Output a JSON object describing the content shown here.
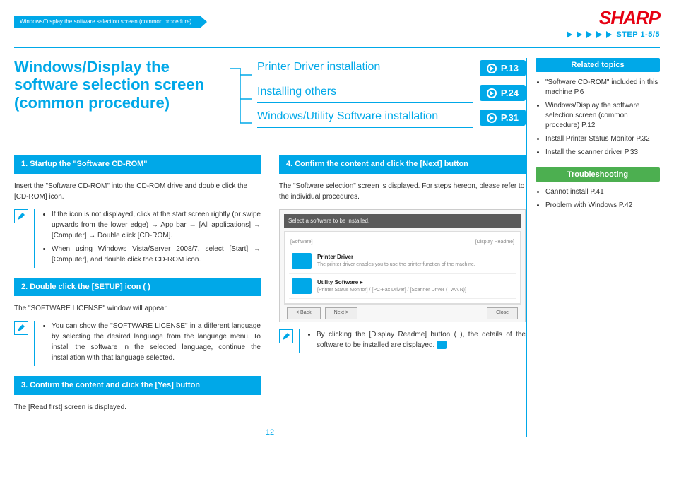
{
  "header": {
    "breadcrumb": "Windows/Display the software selection screen (common procedure)",
    "logo": "SHARP",
    "step": "STEP  1-5/5"
  },
  "title": "Windows/Display the software selection screen (common procedure)",
  "toc": [
    {
      "label": "Printer Driver installation",
      "page": "P.13"
    },
    {
      "label": "Installing others",
      "page": "P.24"
    },
    {
      "label": "Windows/Utility Software installation",
      "page": "P.31"
    }
  ],
  "left": {
    "h1": "1.  Startup the \"Software CD-ROM\"",
    "p1": "Insert the \"Software CD-ROM\" into the CD-ROM drive and double click the [CD-ROM] icon.",
    "n1a": "If the icon is not displayed, click at the start screen rightly (or swipe upwards from the lower edge) → App bar → [All applications] → [Computer] → Double click [CD-ROM].",
    "n1b": "When using Windows Vista/Server 2008/7, select [Start] → [Computer], and double click the CD-ROM icon.",
    "h2": "2.  Double click the [SETUP] icon (      )",
    "p2": "The \"SOFTWARE LICENSE\" window will appear.",
    "n2": "You can show the \"SOFTWARE LICENSE\" in a different language by selecting the desired language from the language menu. To install the software in the selected language, continue the installation with that language selected.",
    "h3": "3.  Confirm the content and click the [Yes] button",
    "p3": "The [Read first] screen is displayed."
  },
  "right": {
    "h4": "4.  Confirm the content and click the [Next] button",
    "p4": "The \"Software selection\" screen is displayed. For steps hereon, please refer to the individual procedures.",
    "n4": "By clicking the [Display Readme] button (      ), the details of the software to be installed are displayed.",
    "ss": {
      "title": "Select a software to be installed.",
      "tabL": "[Software]",
      "tabR": "[Display Readme]",
      "item1t": "Printer Driver",
      "item1d": "The printer driver enables you to use the printer function of the machine.",
      "item2t": "Utility Software ▸",
      "item2d": "[Printer Status Monitor] / [PC-Fax Driver] / [Scanner Driver (TWAIN)]",
      "back": "< Back",
      "next": "Next >",
      "close": "Close"
    }
  },
  "sidebar": {
    "related_head": "Related topics",
    "related": [
      "\"Software CD-ROM\" included in this machine P.6",
      "Windows/Display the software selection screen (common procedure) P.12",
      "Install Printer Status Monitor P.32",
      "Install the scanner driver P.33"
    ],
    "trouble_head": "Troubleshooting",
    "trouble": [
      "Cannot install P.41",
      "Problem with Windows P.42"
    ]
  },
  "footer_page": "12"
}
